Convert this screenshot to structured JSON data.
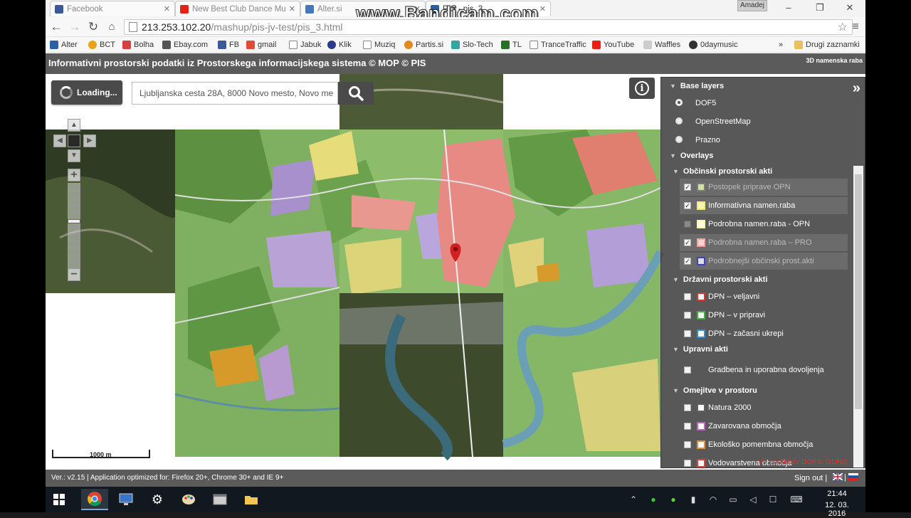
{
  "colors": {
    "header_bg": "#5b5b5b",
    "panel_bg": "#4b4b4b",
    "accent_red": "#d33"
  },
  "watermark": "www.Bandicam.com",
  "tabs": [
    {
      "title": "Facebook",
      "icon": "facebook-icon"
    },
    {
      "title": "New Best Club Dance Mu",
      "icon": "youtube-icon"
    },
    {
      "title": "Alter.si",
      "icon": "alter-icon"
    },
    {
      "title": "PIS - pis_3",
      "icon": "pis-icon"
    }
  ],
  "window": {
    "user": "Amadej"
  },
  "address": {
    "host": "213.253.102.20",
    "path": "/mashup/pis-jv-test/pis_3.html"
  },
  "bookmarks": [
    "Alter",
    "BCT",
    "Bolha",
    "Ebay.com",
    "FB",
    "gmail",
    "Jabuk",
    "Klik",
    "Muziq",
    "Partis.si",
    "Slo-Tech",
    "TL",
    "TranceTraffic",
    "YouTube",
    "Waffles",
    "0daymusic"
  ],
  "bookmarks_more": "»",
  "bookmarks_other": "Drugi zaznamki",
  "app": {
    "title": "Informativni prostorski podatki iz Prostorskega informacijskega sistema  © MOP  © PIS",
    "right_link": "3D namenska raba"
  },
  "map": {
    "loading_label": "Loading...",
    "search_value": "Ljubljanska cesta 28A, 8000 Novo mesto, Novo me",
    "scale_label": "1000 m"
  },
  "layers": {
    "base_title": "Base layers",
    "base": [
      {
        "label": "DOF5",
        "selected": true
      },
      {
        "label": "OpenStreetMap",
        "selected": false
      },
      {
        "label": "Prazno",
        "selected": false
      }
    ],
    "overlays_title": "Overlays",
    "groups": [
      {
        "title": "Občinski prostorski akti",
        "items": [
          {
            "label": "Postopek priprave OPN",
            "checked": true,
            "disabled": true,
            "color": "#cfe3a0"
          },
          {
            "label": "Informativna namen.raba",
            "checked": true,
            "disabled": false,
            "color": "#f3e97a"
          },
          {
            "label": "Podrobna namen.raba - OPN",
            "checked": false,
            "disabled": false,
            "color": "#fdf5b0"
          },
          {
            "label": "Podrobna namen.raba – PRO",
            "checked": true,
            "disabled": true,
            "color": "#f7a0a0"
          },
          {
            "label": "Podrobnejši občinski prost.akti",
            "checked": true,
            "disabled": true,
            "color": "#4040c0"
          }
        ]
      },
      {
        "title": "Državni prostorski akti",
        "items": [
          {
            "label": "DPN – veljavni",
            "checked": false,
            "color": "#e03030"
          },
          {
            "label": "DPN – v pripravi",
            "checked": false,
            "color": "#40b040"
          },
          {
            "label": "DPN – začasni ukrepi",
            "checked": false,
            "color": "#3090d0"
          }
        ]
      },
      {
        "title": "Upravni akti",
        "items": [
          {
            "label": "Gradbena in uporabna dovoljenja",
            "checked": false,
            "color": ""
          }
        ]
      },
      {
        "title": "Omejitve v prostoru",
        "items": [
          {
            "label": "Natura 2000",
            "checked": false,
            "color": "#606060"
          },
          {
            "label": "Zavarovana območja",
            "checked": false,
            "color": "#c060c0"
          },
          {
            "label": "Ekološko pomembna območja",
            "checked": false,
            "color": "#e09040"
          },
          {
            "label": "Vodovarstvena območja",
            "checked": false,
            "color": "#e04040"
          }
        ]
      }
    ],
    "status_text": "Vir podatkov DOF5: GURS"
  },
  "footer": {
    "version": "Ver.: v2.15 | Application optimized for: Firefox 20+, Chrome 30+ and IE 9+",
    "signout": "Sign out  |",
    "sep": "|"
  },
  "taskbar": {
    "time": "21:44",
    "date": "12. 03. 2016"
  }
}
